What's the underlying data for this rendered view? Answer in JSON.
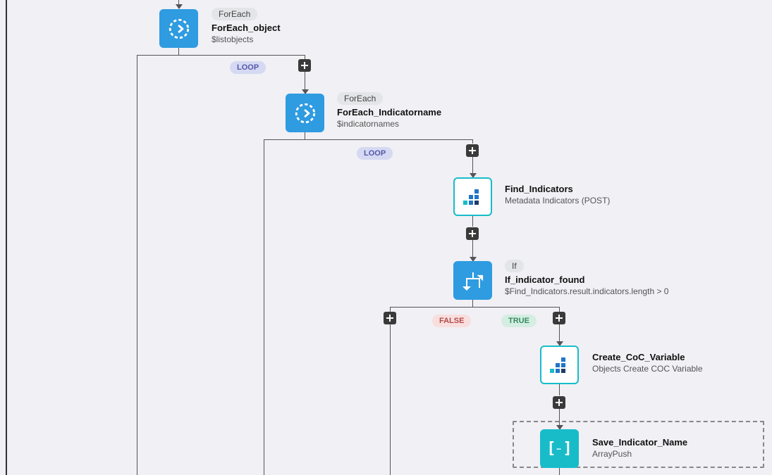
{
  "badges": {
    "loop": "LOOP",
    "true": "TRUE",
    "false": "FALSE"
  },
  "nodes": {
    "foreach_object": {
      "type_label": "ForEach",
      "title": "ForEach_object",
      "subtitle": "$listobjects"
    },
    "foreach_indicator": {
      "type_label": "ForEach",
      "title": "ForEach_Indicatorname",
      "subtitle": "$indicatornames"
    },
    "find_indicators": {
      "title": "Find_Indicators",
      "subtitle": "Metadata Indicators (POST)"
    },
    "if_indicator_found": {
      "type_label": "If",
      "title": "If_indicator_found",
      "subtitle": "$Find_Indicators.result.indicators.length > 0"
    },
    "create_coc": {
      "title": "Create_CoC_Variable",
      "subtitle": "Objects Create COC Variable"
    },
    "save_indicator": {
      "title": "Save_Indicator_Name",
      "subtitle": "ArrayPush"
    }
  }
}
